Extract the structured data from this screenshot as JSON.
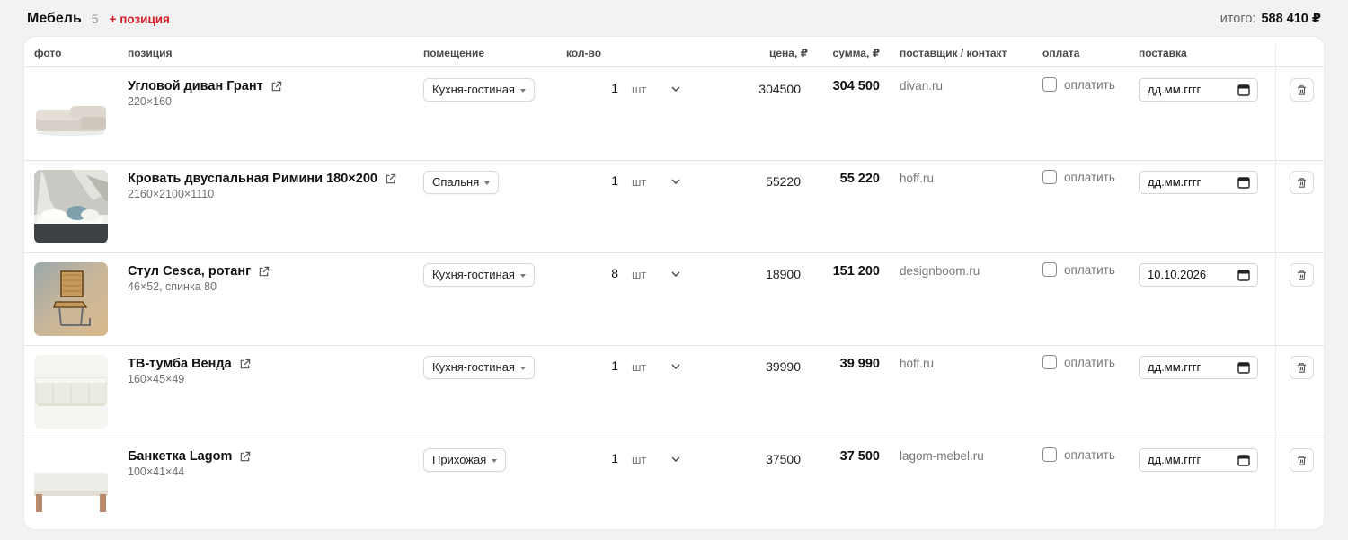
{
  "header": {
    "title": "Мебель",
    "count": "5",
    "add_label": "+ позиция",
    "total_label": "итого:",
    "total_value": "588 410 ₽"
  },
  "columns": {
    "photo": "фото",
    "item": "позиция",
    "room": "помещение",
    "qty": "кол-во",
    "price": "цена, ₽",
    "sum": "сумма, ₽",
    "supplier": "поставщик / контакт",
    "payment": "оплата",
    "delivery": "поставка"
  },
  "rows": [
    {
      "photo_icon": "corner-sofa-photo",
      "name": "Угловой диван Грант",
      "size": "220×160",
      "room": "Кухня-гостиная",
      "qty": "1",
      "unit": "шт",
      "price": "304500",
      "sum": "304 500",
      "supplier": "divan.ru",
      "pay_label": "оплатить",
      "paid": false,
      "date": "дд.мм.гггг"
    },
    {
      "photo_icon": "double-bed-photo",
      "name": "Кровать двуспальная Римини 180×200",
      "size": "2160×2100×1110",
      "room": "Спальня",
      "qty": "1",
      "unit": "шт",
      "price": "55220",
      "sum": "55 220",
      "supplier": "hoff.ru",
      "pay_label": "оплатить",
      "paid": false,
      "date": "дд.мм.гггг"
    },
    {
      "photo_icon": "cesca-chair-photo",
      "name": "Стул Cesca, ротанг",
      "size": "46×52, спинка 80",
      "room": "Кухня-гостиная",
      "qty": "8",
      "unit": "шт",
      "price": "18900",
      "sum": "151 200",
      "supplier": "designboom.ru",
      "pay_label": "оплатить",
      "paid": false,
      "date": "10.10.2026"
    },
    {
      "photo_icon": "tv-stand-photo",
      "name": "ТВ-тумба Венда",
      "size": "160×45×49",
      "room": "Кухня-гостиная",
      "qty": "1",
      "unit": "шт",
      "price": "39990",
      "sum": "39 990",
      "supplier": "hoff.ru",
      "pay_label": "оплатить",
      "paid": false,
      "date": "дд.мм.гггг"
    },
    {
      "photo_icon": "bench-photo",
      "name": "Банкетка Lagom",
      "size": "100×41×44",
      "room": "Прихожая",
      "qty": "1",
      "unit": "шт",
      "price": "37500",
      "sum": "37 500",
      "supplier": "lagom-mebel.ru",
      "pay_label": "оплатить",
      "paid": false,
      "date": "дд.мм.гггг"
    }
  ]
}
